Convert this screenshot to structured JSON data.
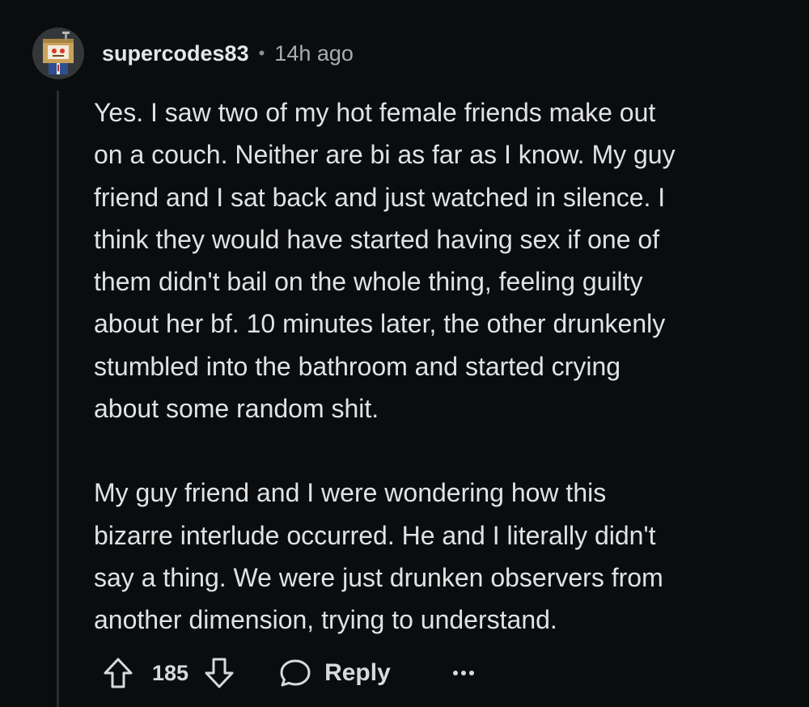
{
  "comment": {
    "author": "supercodes83",
    "separator": "•",
    "timestamp": "14h ago",
    "paragraphs": [
      "Yes. I saw two of my hot female friends make out\non a couch. Neither are bi as far as I know. My guy\nfriend and I sat back and just watched in silence. I\nthink they would have started having sex if one of\nthem didn't bail on the whole thing, feeling guilty\nabout her bf. 10 minutes later, the other drunkenly\nstumbled into the bathroom and started crying\nabout some random shit.",
      "My guy friend and I were wondering how this\nbizarre interlude occurred. He and I literally didn't\nsay a thing. We were just drunken observers from\nanother dimension, trying to understand."
    ],
    "avatar_icon": "avatar-icon"
  },
  "actions": {
    "upvote_icon": "arrow-up-icon",
    "score": "185",
    "downvote_icon": "arrow-down-icon",
    "reply_icon": "speech-bubble-icon",
    "reply_label": "Reply",
    "more_icon": "more-dots-icon"
  },
  "colors": {
    "background": "#0b0c0d",
    "text": "#e0e2e4",
    "muted": "#a9adb1",
    "thread_line": "#2a2c2e"
  }
}
